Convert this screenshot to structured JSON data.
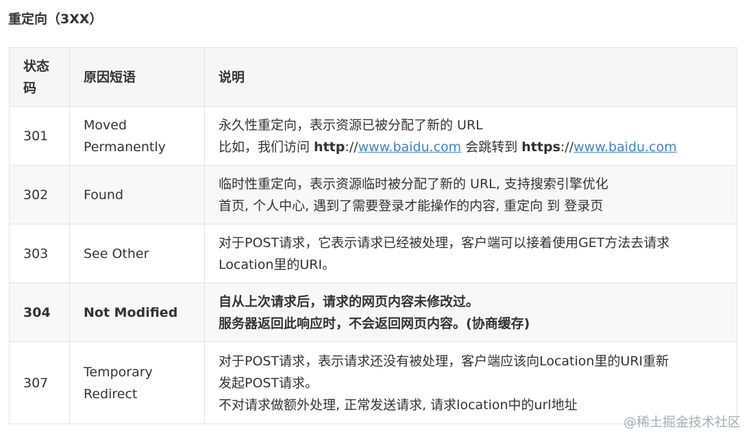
{
  "heading": "重定向（3XX）",
  "table": {
    "headers": {
      "code": "状态码",
      "reason": "原因短语",
      "desc": "说明"
    },
    "rows": [
      {
        "code": "301",
        "reason": "Moved Permanently",
        "line1": "永久性重定向，表示资源已被分配了新的 URL",
        "line2_prefix": "比如，我们访问 ",
        "line2_scheme1": "http",
        "line2_sep1": "://",
        "line2_link1": "www.baidu.com",
        "line2_mid": " 会跳转到 ",
        "line2_scheme2": "https",
        "line2_sep2": "://",
        "line2_link2": "www.baidu.com"
      },
      {
        "code": "302",
        "reason": "Found",
        "line1": "临时性重定向，表示资源临时被分配了新的 URL, 支持搜索引擎优化",
        "line2": "首页, 个人中心, 遇到了需要登录才能操作的内容, 重定向 到 登录页"
      },
      {
        "code": "303",
        "reason": "See Other",
        "line1": "对于POST请求，它表示请求已经被处理，客户端可以接着使用GET方法去请求",
        "line2": "Location里的URI。"
      },
      {
        "code": "304",
        "reason": "Not Modified",
        "line1": "自从上次请求后，请求的网页内容未修改过。",
        "line2": "服务器返回此响应时，不会返回网页内容。(协商缓存)"
      },
      {
        "code": "307",
        "reason": "Temporary Redirect",
        "line1": "对于POST请求，表示请求还没有被处理，客户端应该向Location里的URI重新",
        "line2": "发起POST请求。",
        "line3": "不对请求做额外处理, 正常发送请求, 请求location中的url地址"
      }
    ]
  },
  "watermark": "@稀土掘金技术社区"
}
